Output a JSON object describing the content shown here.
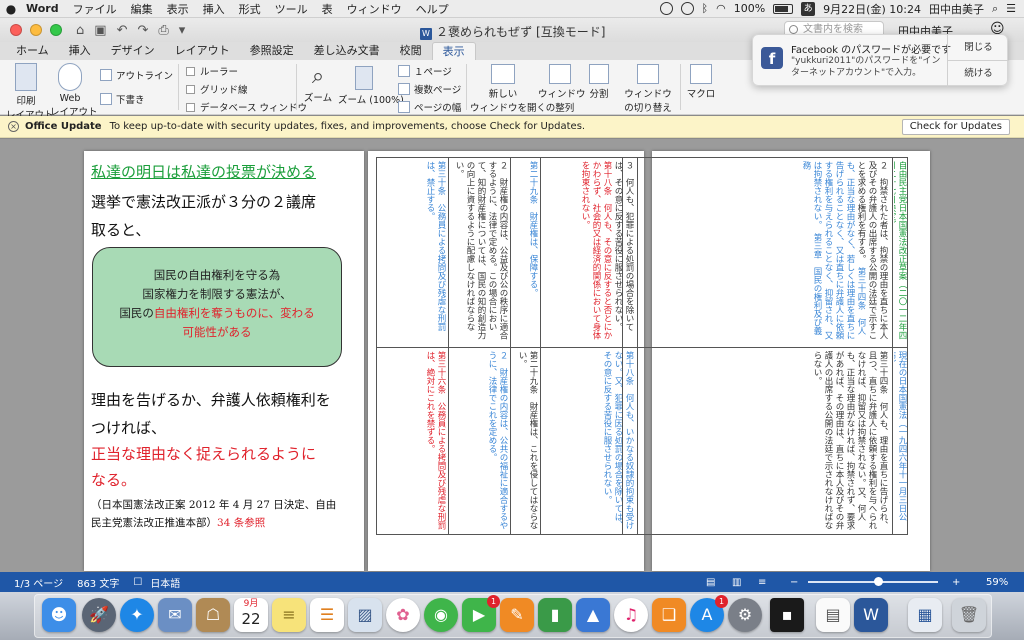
{
  "menubar": {
    "app": "Word",
    "items": [
      "ファイル",
      "編集",
      "表示",
      "挿入",
      "形式",
      "ツール",
      "表",
      "ウィンドウ",
      "ヘルプ"
    ],
    "battery": "100%",
    "ime": "あ",
    "datetime": "9月22日(金)  10:24",
    "user": "田中由美子"
  },
  "window": {
    "title": "２褒められもぜず [互換モード]",
    "search_placeholder": "文書内を検索",
    "user": "田中由美子"
  },
  "tabs": [
    "ホーム",
    "挿入",
    "デザイン",
    "レイアウト",
    "参照設定",
    "差し込み文書",
    "校閲",
    "表示"
  ],
  "active_tab": "表示",
  "ribbon": {
    "print_layout": "印刷\nレイアウト",
    "print_layout_a": "印刷",
    "print_layout_b": "レイアウト",
    "web_layout_a": "Web",
    "web_layout_b": "レイアウト",
    "outline": "アウトライン",
    "draft": "下書き",
    "ruler": "ルーラー",
    "gridlines": "グリッド線",
    "db_window": "データベース ウィンドウ",
    "zoom": "ズーム",
    "zoom100": "ズーム (100%)",
    "one_page": "１ページ",
    "multi_page": "複数ページ",
    "page_width": "ページの幅",
    "new_window_a": "新しい",
    "new_window_b": "ウィンドウを開く",
    "arrange_a": "ウィンドウ",
    "arrange_b": "の整列",
    "split": "分割",
    "switch_a": "ウィンドウ",
    "switch_b": "の切り替え",
    "macro": "マクロ"
  },
  "notification": {
    "title": "Facebook のパスワードが必要です",
    "body": "\"yukkuri2011\"のパスワードを\"インターネットアカウント\"で入力。",
    "close": "閉じる",
    "continue": "続ける"
  },
  "update_bar": {
    "title": "Office Update",
    "message": "To keep up-to-date with security updates, fixes, and improvements, choose Check for Updates.",
    "button": "Check for Updates"
  },
  "page1": {
    "heading": "私達の明日は私達の投票が決める",
    "line1": "選挙で憲法改正派が３分の２議席",
    "line2": "取ると、",
    "callout": {
      "l1": "国民の自由権利を守る為",
      "l2": "国家権力を制限する憲法が、",
      "l3a": "国民の",
      "l3b": "自由権利を奪うものに、変わる",
      "l4": "可能性がある"
    },
    "line3": "理由を告げるか、弁護人依頼権利を",
    "line4": "つければ、",
    "line5": "正当な理由なく捉えられるように",
    "line6": "なる。",
    "note1": "（日本国憲法改正案 2012 年 4 月 27 日決定、自由",
    "note2a": "民主党憲法改正推進本部）",
    "note2b": "34 条参照"
  },
  "page2": {
    "cols": [
      "第三十条　公務員による拷問及び残虐な刑罰は、禁止する。",
      "２　財産権の内容は、公益及び公の秩序に適合するように、法律で定める。この場合において、知的財産権については、国民の知的創造力の向上に資するように配慮しなければならない。",
      "第二十九条　財産権は、保障する。",
      "３　何人も、犯罪による処罰の場合を除いては、その意に反する苦役に服させられない。",
      "第十八条　何人も、その意に反すると否とにかかわらず、社会的又は経済的関係において身体を拘束されない。",
      "第三十六条　公務員による拷問及び残虐な刑罰は、絶対にこれを禁ずる。",
      "２　財産権の内容は、公共の福祉に適合するやうに、法律でこれを定める。",
      "第二十九条　財産権は、これを侵してはならない。",
      "第十八条　何人も、いかなる奴隷的拘束も受けない。又、犯罪に因る処罰の場合を除いては、その意に反する苦役に服させられない。"
    ]
  },
  "page3": {
    "cols": [
      "自由民主党日本国憲法改正草案（二〇一二年四月二十七日決定）",
      "第三章　国民の権利及び義務",
      "第三十四条　何人も、正当な理由がなく、若しくは理由を直ちに告げられることなく、又は直ちに弁護人に依頼する権利を与えられることなく、抑留され、又は拘禁されない。",
      "２　拘禁された者は、拘禁の理由を直ちに本人及びその弁護人の出席する公開の法廷で示すことを求める権利を有する。",
      "現在の日本国憲法（一九四六年十一月三日公布）",
      "第三十四条　何人も、理由を直ちに告げられ、且つ、直ちに弁護人に依頼する権利を与へられなければ、抑留又は拘禁されない。又、何人も、正当な理由がなければ、拘禁されず、要求があれば、その理由は、直ちに本人及びその弁護人の出席する公開の法廷で示されなければならない。"
    ]
  },
  "status": {
    "page": "1/3 ページ",
    "words": "863 文字",
    "language": "日本語",
    "zoom": "59%",
    "zoom_value": 59
  },
  "dock": {
    "apps": [
      "Finder",
      "Launchpad",
      "Safari",
      "Mail",
      "Contacts",
      "Calendar",
      "Notes",
      "Reminders",
      "Preview",
      "Photos",
      "Messages",
      "FaceTime",
      "Pages",
      "Numbers",
      "Keynote",
      "iTunes",
      "iBooks",
      "App Store",
      "System Preferences",
      "TextEdit",
      "Word",
      "Downloads",
      "Trash"
    ],
    "calendar_day": "22",
    "calendar_month": "9月",
    "facetime_badge": "1",
    "appstore_badge": "1"
  },
  "colors": {
    "accent": "#2b579a",
    "status": "#1f57a7",
    "green": "#1a9e3a",
    "red": "#e0222c",
    "callout": "#a8dab5"
  }
}
